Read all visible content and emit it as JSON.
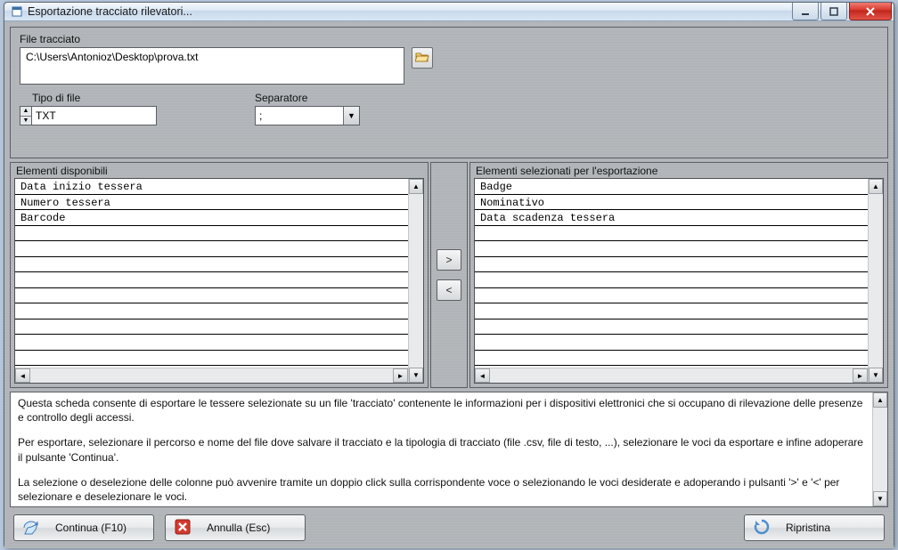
{
  "titlebar": {
    "title": "Esportazione tracciato rilevatori..."
  },
  "top": {
    "file_label": "File tracciato",
    "file_value": "C:\\Users\\Antonioz\\Desktop\\prova.txt",
    "type_label": "Tipo di file",
    "type_value": "TXT",
    "separator_label": "Separatore",
    "separator_value": ";"
  },
  "lists": {
    "available_title": "Elementi disponibili",
    "available_items": [
      "Data inizio tessera",
      "Numero tessera",
      "Barcode"
    ],
    "selected_title": "Elementi selezionati per l'esportazione",
    "selected_items": [
      "Badge",
      "Nominativo",
      "Data scadenza tessera"
    ],
    "move_right": ">",
    "move_left": "<"
  },
  "instructions": {
    "p1": "Questa scheda consente di esportare le tessere selezionate su un file 'tracciato' contenente le informazioni per i dispositivi elettronici che si occupano di rilevazione delle presenze e controllo degli accessi.",
    "p2": "Per esportare, selezionare il percorso e nome del file dove salvare il tracciato e la tipologia di tracciato (file .csv, file di testo, ...), selezionare le voci da esportare e infine adoperare il pulsante 'Continua'.",
    "p3": "La selezione o deselezione delle colonne può avvenire tramite un doppio click sulla corrispondente voce o selezionando le voci desiderate e adoperando i pulsanti '>' e '<' per selezionare e deselezionare le voci."
  },
  "buttons": {
    "continue": "Continua (F10)",
    "cancel": "Annulla (Esc)",
    "restore": "Ripristina"
  }
}
